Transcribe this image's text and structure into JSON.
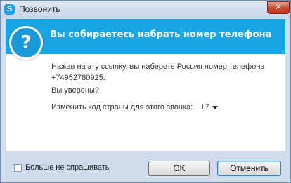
{
  "window": {
    "title": "Позвонить",
    "close_glyph": "✕",
    "app_icon_letter": "S"
  },
  "header": {
    "icon_glyph": "?",
    "heading": "Вы собираетесь набрать номер телефона"
  },
  "body": {
    "message": "Нажав на эту ссылку, вы наберете Россия номер телефона +74952780925.",
    "confirm": "Вы уверены?",
    "country_code_label": "Изменить код страны для этого звонка:",
    "country_code_value": "+7"
  },
  "footer": {
    "dont_ask_label": "Больше не спрашивать",
    "ok_label": "OK",
    "cancel_label": "Отменить"
  },
  "colors": {
    "header_band": "#1aa6e4",
    "question_icon": "#1a99d8",
    "window_frame": "#cfdcec"
  },
  "icons": [
    "skype-icon",
    "close-icon",
    "question-icon",
    "chevron-down-icon"
  ]
}
